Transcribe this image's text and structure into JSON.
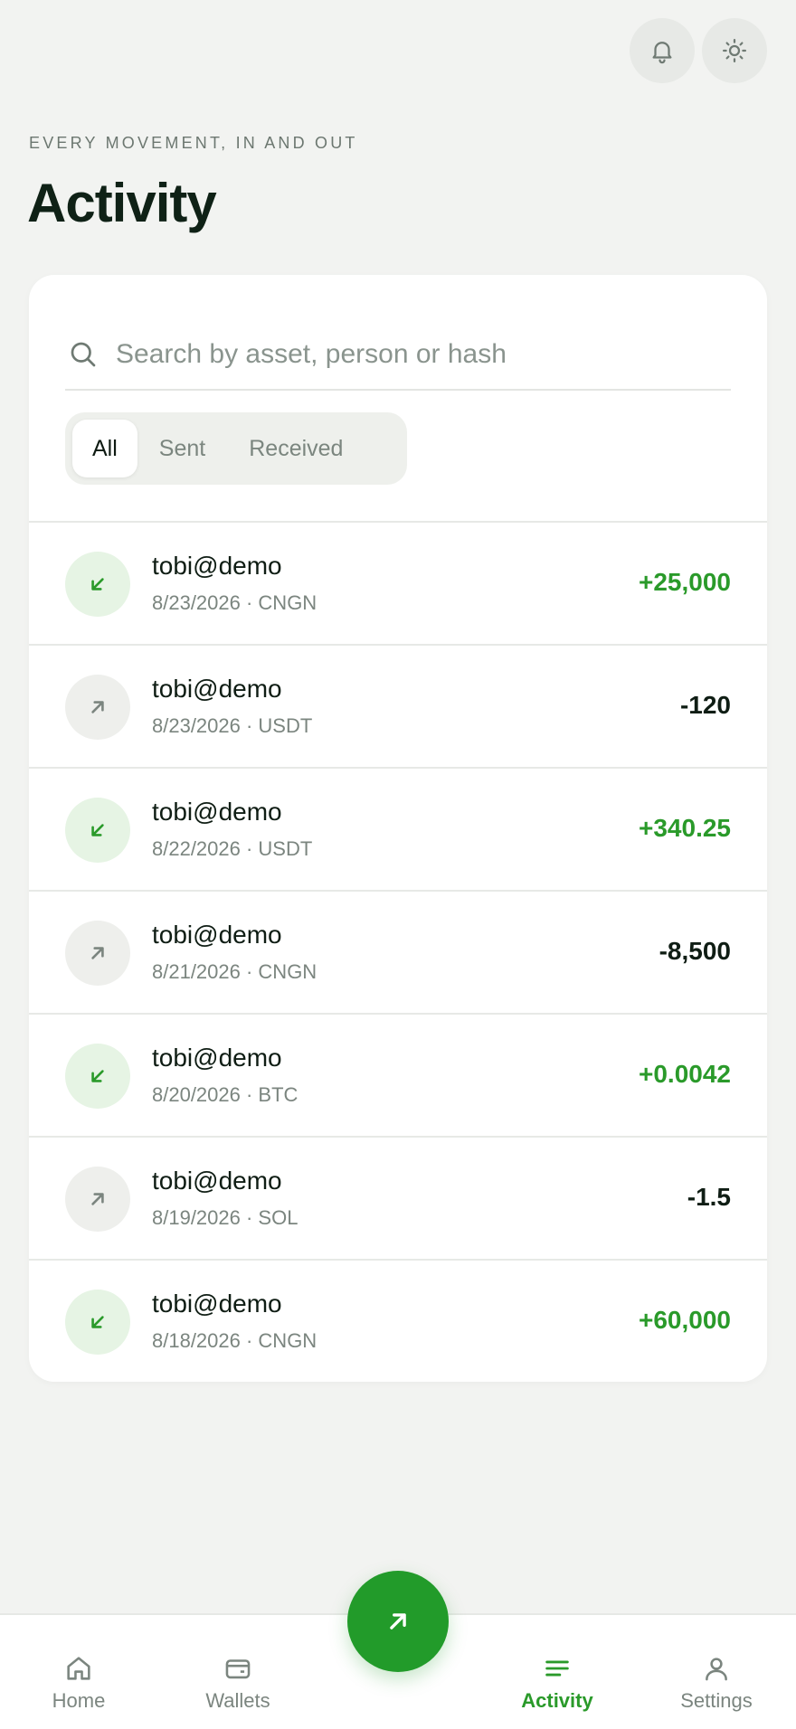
{
  "header": {
    "eyebrow": "EVERY MOVEMENT, IN AND OUT",
    "title": "Activity"
  },
  "search": {
    "placeholder": "Search by asset, person or hash",
    "value": ""
  },
  "filters": [
    {
      "label": "All",
      "active": true
    },
    {
      "label": "Sent",
      "active": false
    },
    {
      "label": "Received",
      "active": false
    }
  ],
  "transactions": [
    {
      "direction": "in",
      "name": "tobi@demo",
      "meta": "8/23/2026 · CNGN",
      "amount": "+25,000"
    },
    {
      "direction": "out",
      "name": "tobi@demo",
      "meta": "8/23/2026 · USDT",
      "amount": "-120"
    },
    {
      "direction": "in",
      "name": "tobi@demo",
      "meta": "8/22/2026 · USDT",
      "amount": "+340.25"
    },
    {
      "direction": "out",
      "name": "tobi@demo",
      "meta": "8/21/2026 · CNGN",
      "amount": "-8,500"
    },
    {
      "direction": "in",
      "name": "tobi@demo",
      "meta": "8/20/2026 · BTC",
      "amount": "+0.0042"
    },
    {
      "direction": "out",
      "name": "tobi@demo",
      "meta": "8/19/2026 · SOL",
      "amount": "-1.5"
    },
    {
      "direction": "in",
      "name": "tobi@demo",
      "meta": "8/18/2026 · CNGN",
      "amount": "+60,000"
    }
  ],
  "nav": {
    "home": "Home",
    "wallets": "Wallets",
    "activity": "Activity",
    "settings": "Settings",
    "active": "activity"
  },
  "icons": {
    "notifications": "bell-icon",
    "theme": "sun-icon",
    "search": "search-icon",
    "incoming": "arrow-down-left-icon",
    "outgoing": "arrow-up-right-icon",
    "fab": "arrow-up-right-icon"
  },
  "colors": {
    "accent": "#229b2a",
    "positive": "#2a9a2a",
    "background": "#f2f3f1"
  }
}
